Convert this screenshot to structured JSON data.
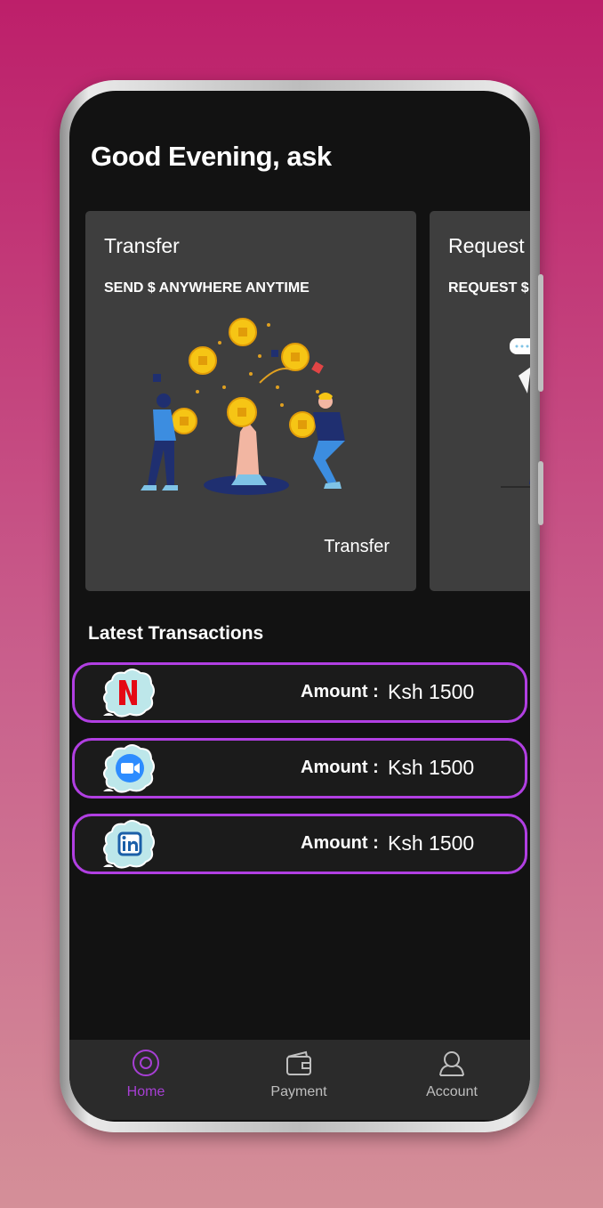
{
  "greeting": "Good Evening, ask",
  "cards": [
    {
      "title": "Transfer",
      "subtitle": "SEND $ ANYWHERE ANYTIME",
      "action": "Transfer"
    },
    {
      "title": "Request",
      "subtitle": "REQUEST $",
      "action": ""
    }
  ],
  "transactions_title": "Latest Transactions",
  "transactions": [
    {
      "service_icon": "netflix-icon",
      "amount_label": "Amount :",
      "amount": "Ksh 1500"
    },
    {
      "service_icon": "zoom-icon",
      "amount_label": "Amount :",
      "amount": "Ksh 1500"
    },
    {
      "service_icon": "linkedin-icon",
      "amount_label": "Amount :",
      "amount": "Ksh 1500"
    }
  ],
  "nav": [
    {
      "label": "Home",
      "icon": "home-icon",
      "active": true
    },
    {
      "label": "Payment",
      "icon": "wallet-icon",
      "active": false
    },
    {
      "label": "Account",
      "icon": "account-icon",
      "active": false
    }
  ],
  "colors": {
    "accent": "#a63fd3",
    "tx_border": "#b13fe2",
    "card_bg": "#3e3e3e",
    "screen_bg": "#121212"
  }
}
